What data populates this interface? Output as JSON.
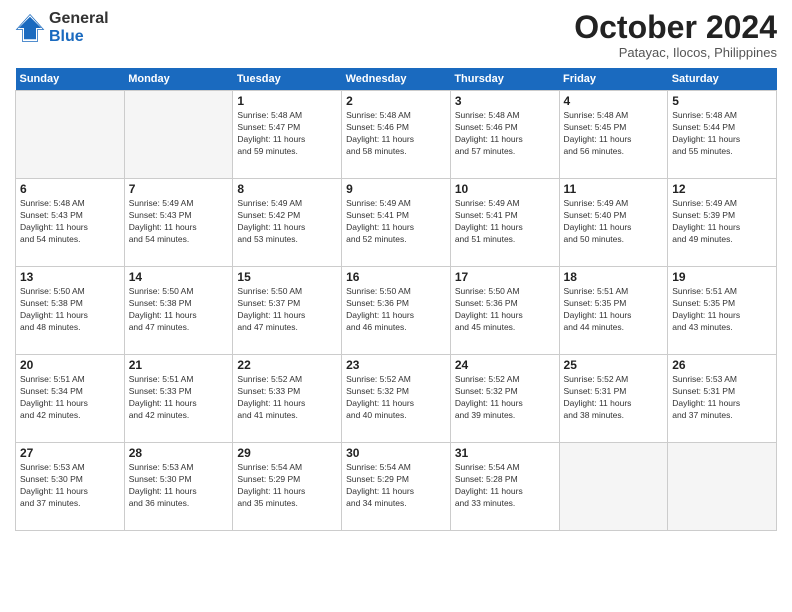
{
  "logo": {
    "general": "General",
    "blue": "Blue"
  },
  "header": {
    "month": "October 2024",
    "location": "Patayac, Ilocos, Philippines"
  },
  "weekdays": [
    "Sunday",
    "Monday",
    "Tuesday",
    "Wednesday",
    "Thursday",
    "Friday",
    "Saturday"
  ],
  "weeks": [
    [
      {
        "day": "",
        "info": ""
      },
      {
        "day": "",
        "info": ""
      },
      {
        "day": "1",
        "info": "Sunrise: 5:48 AM\nSunset: 5:47 PM\nDaylight: 11 hours\nand 59 minutes."
      },
      {
        "day": "2",
        "info": "Sunrise: 5:48 AM\nSunset: 5:46 PM\nDaylight: 11 hours\nand 58 minutes."
      },
      {
        "day": "3",
        "info": "Sunrise: 5:48 AM\nSunset: 5:46 PM\nDaylight: 11 hours\nand 57 minutes."
      },
      {
        "day": "4",
        "info": "Sunrise: 5:48 AM\nSunset: 5:45 PM\nDaylight: 11 hours\nand 56 minutes."
      },
      {
        "day": "5",
        "info": "Sunrise: 5:48 AM\nSunset: 5:44 PM\nDaylight: 11 hours\nand 55 minutes."
      }
    ],
    [
      {
        "day": "6",
        "info": "Sunrise: 5:48 AM\nSunset: 5:43 PM\nDaylight: 11 hours\nand 54 minutes."
      },
      {
        "day": "7",
        "info": "Sunrise: 5:49 AM\nSunset: 5:43 PM\nDaylight: 11 hours\nand 54 minutes."
      },
      {
        "day": "8",
        "info": "Sunrise: 5:49 AM\nSunset: 5:42 PM\nDaylight: 11 hours\nand 53 minutes."
      },
      {
        "day": "9",
        "info": "Sunrise: 5:49 AM\nSunset: 5:41 PM\nDaylight: 11 hours\nand 52 minutes."
      },
      {
        "day": "10",
        "info": "Sunrise: 5:49 AM\nSunset: 5:41 PM\nDaylight: 11 hours\nand 51 minutes."
      },
      {
        "day": "11",
        "info": "Sunrise: 5:49 AM\nSunset: 5:40 PM\nDaylight: 11 hours\nand 50 minutes."
      },
      {
        "day": "12",
        "info": "Sunrise: 5:49 AM\nSunset: 5:39 PM\nDaylight: 11 hours\nand 49 minutes."
      }
    ],
    [
      {
        "day": "13",
        "info": "Sunrise: 5:50 AM\nSunset: 5:38 PM\nDaylight: 11 hours\nand 48 minutes."
      },
      {
        "day": "14",
        "info": "Sunrise: 5:50 AM\nSunset: 5:38 PM\nDaylight: 11 hours\nand 47 minutes."
      },
      {
        "day": "15",
        "info": "Sunrise: 5:50 AM\nSunset: 5:37 PM\nDaylight: 11 hours\nand 47 minutes."
      },
      {
        "day": "16",
        "info": "Sunrise: 5:50 AM\nSunset: 5:36 PM\nDaylight: 11 hours\nand 46 minutes."
      },
      {
        "day": "17",
        "info": "Sunrise: 5:50 AM\nSunset: 5:36 PM\nDaylight: 11 hours\nand 45 minutes."
      },
      {
        "day": "18",
        "info": "Sunrise: 5:51 AM\nSunset: 5:35 PM\nDaylight: 11 hours\nand 44 minutes."
      },
      {
        "day": "19",
        "info": "Sunrise: 5:51 AM\nSunset: 5:35 PM\nDaylight: 11 hours\nand 43 minutes."
      }
    ],
    [
      {
        "day": "20",
        "info": "Sunrise: 5:51 AM\nSunset: 5:34 PM\nDaylight: 11 hours\nand 42 minutes."
      },
      {
        "day": "21",
        "info": "Sunrise: 5:51 AM\nSunset: 5:33 PM\nDaylight: 11 hours\nand 42 minutes."
      },
      {
        "day": "22",
        "info": "Sunrise: 5:52 AM\nSunset: 5:33 PM\nDaylight: 11 hours\nand 41 minutes."
      },
      {
        "day": "23",
        "info": "Sunrise: 5:52 AM\nSunset: 5:32 PM\nDaylight: 11 hours\nand 40 minutes."
      },
      {
        "day": "24",
        "info": "Sunrise: 5:52 AM\nSunset: 5:32 PM\nDaylight: 11 hours\nand 39 minutes."
      },
      {
        "day": "25",
        "info": "Sunrise: 5:52 AM\nSunset: 5:31 PM\nDaylight: 11 hours\nand 38 minutes."
      },
      {
        "day": "26",
        "info": "Sunrise: 5:53 AM\nSunset: 5:31 PM\nDaylight: 11 hours\nand 37 minutes."
      }
    ],
    [
      {
        "day": "27",
        "info": "Sunrise: 5:53 AM\nSunset: 5:30 PM\nDaylight: 11 hours\nand 37 minutes."
      },
      {
        "day": "28",
        "info": "Sunrise: 5:53 AM\nSunset: 5:30 PM\nDaylight: 11 hours\nand 36 minutes."
      },
      {
        "day": "29",
        "info": "Sunrise: 5:54 AM\nSunset: 5:29 PM\nDaylight: 11 hours\nand 35 minutes."
      },
      {
        "day": "30",
        "info": "Sunrise: 5:54 AM\nSunset: 5:29 PM\nDaylight: 11 hours\nand 34 minutes."
      },
      {
        "day": "31",
        "info": "Sunrise: 5:54 AM\nSunset: 5:28 PM\nDaylight: 11 hours\nand 33 minutes."
      },
      {
        "day": "",
        "info": ""
      },
      {
        "day": "",
        "info": ""
      }
    ]
  ]
}
